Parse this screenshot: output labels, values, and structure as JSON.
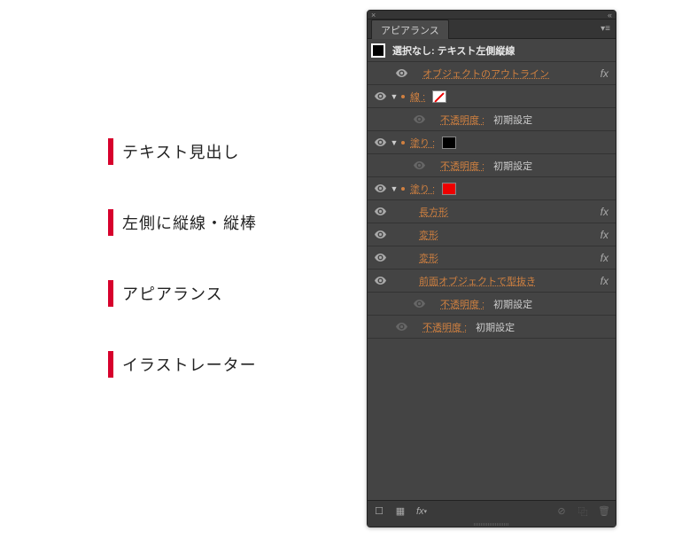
{
  "left_headings": [
    "テキスト見出し",
    "左側に縦線・縦棒",
    "アピアランス",
    "イラストレーター"
  ],
  "panel": {
    "tab": "アピアランス",
    "selection_label": "選択なし: テキスト左側縦線",
    "rows": {
      "outline_label": "オブジェクトのアウトライン",
      "stroke_label": "線 :",
      "opacity_label": "不透明度 :",
      "opacity_value": "初期設定",
      "fill_label": "塗り :",
      "rect_label": "長方形",
      "transform_label": "変形",
      "transform_label2": "変形",
      "knockout_label": "前面オブジェクトで型抜き"
    },
    "fx": "fx"
  }
}
